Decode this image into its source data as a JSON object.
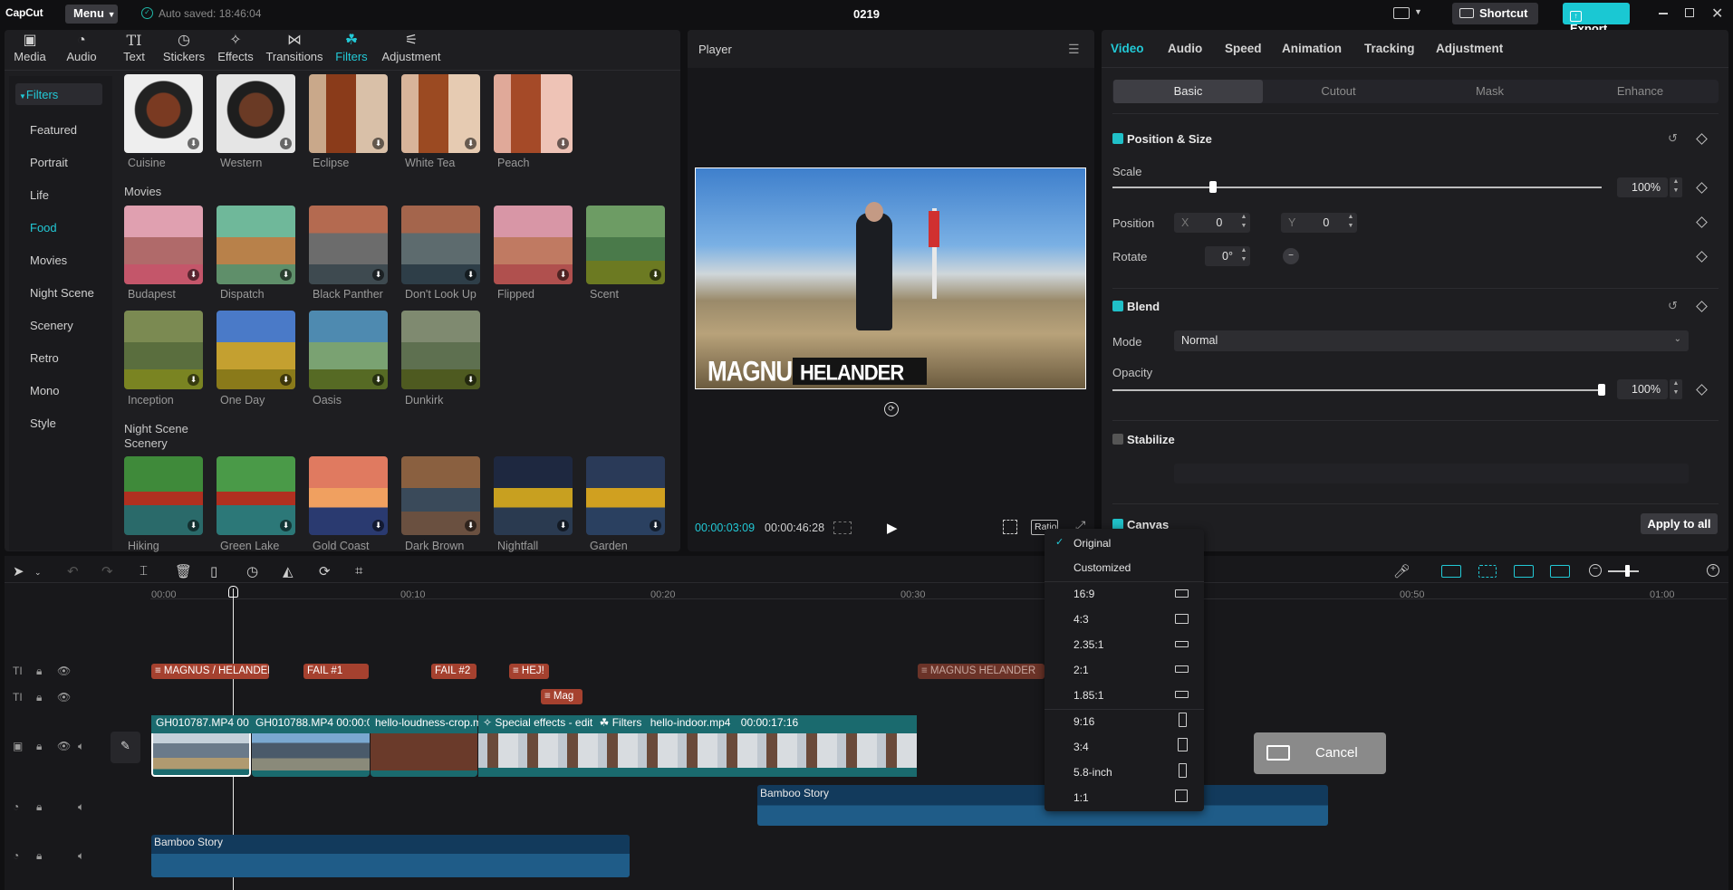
{
  "titlebar": {
    "logo": "CapCut",
    "menu": "Menu",
    "autosave": "Auto saved: 18:46:04",
    "project": "0219",
    "shortcut": "Shortcut",
    "export": "Export"
  },
  "media_tabs": [
    {
      "label": "Media",
      "icon": "media-icon"
    },
    {
      "label": "Audio",
      "icon": "audio-icon"
    },
    {
      "label": "Text",
      "icon": "text-icon"
    },
    {
      "label": "Stickers",
      "icon": "stickers-icon"
    },
    {
      "label": "Effects",
      "icon": "effects-icon"
    },
    {
      "label": "Transitions",
      "icon": "transitions-icon"
    },
    {
      "label": "Filters",
      "icon": "filters-icon"
    },
    {
      "label": "Adjustment",
      "icon": "adjustment-icon"
    }
  ],
  "filter_sidebar": {
    "header": "Filters",
    "items": [
      "Featured",
      "Portrait",
      "Life",
      "Food",
      "Movies",
      "Night Scene",
      "Scenery",
      "Retro",
      "Mono",
      "Style"
    ],
    "active": "Food"
  },
  "filters": {
    "food": [
      "Cuisine",
      "Western",
      "Eclipse",
      "White Tea",
      "Peach"
    ],
    "movies_title": "Movies",
    "movies": [
      "Budapest",
      "Dispatch",
      "Black Panther",
      "Don't Look Up",
      "Flipped",
      "Scent",
      "Inception",
      "One Day",
      "Oasis",
      "Dunkirk"
    ],
    "night_title_1": "Night Scene",
    "night_title_2": "Scenery",
    "night": [
      "Hiking",
      "Green Lake",
      "Gold Coast",
      "Dark Brown",
      "Nightfall",
      "Garden"
    ]
  },
  "player": {
    "title": "Player",
    "current_time": "00:00:03:09",
    "total_time": "00:00:46:28",
    "ratio_label": "Ratio",
    "overlay_name1": "MAGNUS",
    "overlay_name2": "HELANDER"
  },
  "inspector": {
    "tabs": [
      "Video",
      "Audio",
      "Speed",
      "Animation",
      "Tracking",
      "Adjustment"
    ],
    "subtabs": [
      "Basic",
      "Cutout",
      "Mask",
      "Enhance"
    ],
    "position_size": "Position & Size",
    "scale_label": "Scale",
    "scale_value": "100%",
    "scale_fraction": 0.205,
    "position_label": "Position",
    "x_label": "X",
    "x_value": "0",
    "y_label": "Y",
    "y_value": "0",
    "rotate_label": "Rotate",
    "rotate_value": "0°",
    "blend": "Blend",
    "mode_label": "Mode",
    "mode_value": "Normal",
    "opacity_label": "Opacity",
    "opacity_value": "100%",
    "opacity_fraction": 1.0,
    "stabilize": "Stabilize",
    "canvas": "Canvas",
    "apply_all": "Apply to all"
  },
  "ratio_menu": [
    {
      "label": "Original",
      "checked": true
    },
    {
      "label": "Customized"
    },
    {
      "label": "16:9"
    },
    {
      "label": "4:3"
    },
    {
      "label": "2.35:1"
    },
    {
      "label": "2:1"
    },
    {
      "label": "1.85:1"
    },
    {
      "label": "9:16"
    },
    {
      "label": "3:4"
    },
    {
      "label": "5.8-inch"
    },
    {
      "label": "1:1"
    }
  ],
  "timeline": {
    "ruler": [
      "00:00",
      "00:10",
      "00:20",
      "00:30",
      "00:50",
      "01:00"
    ],
    "text_clips": [
      "MAGNUS / HELANDER",
      "FAIL #1",
      "FAIL #2",
      "HEJ!",
      "Mag",
      "MAGNUS HELANDER"
    ],
    "video_clips": [
      "GH010787.MP4",
      "00",
      "GH010788.MP4",
      "00:00:0",
      "hello-loudness-crop.m",
      "Special effects - edit",
      "Filters",
      "hello-indoor.mp4",
      "00:00:17:16"
    ],
    "audio_clips": [
      "Bamboo Story",
      "Bamboo Story"
    ],
    "cancel": "Cancel"
  }
}
